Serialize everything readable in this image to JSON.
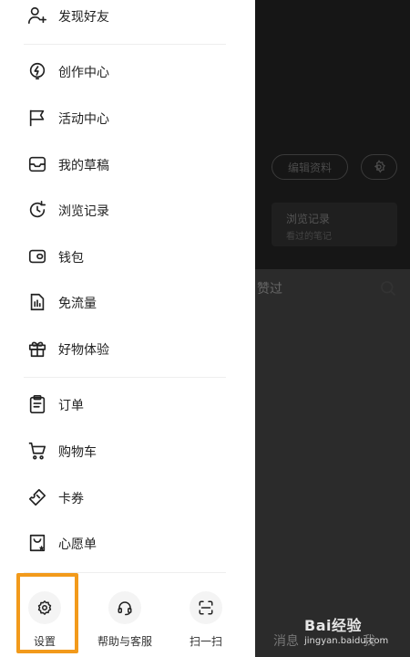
{
  "background": {
    "edit_label": "编辑资料",
    "history_title": "浏览记录",
    "history_sub": "看过的笔记",
    "seen_label": "赞过",
    "tab_messages": "消息",
    "tab_me": "我"
  },
  "watermark": {
    "logo": "Bai经验",
    "url": "jingyan.baidu.com"
  },
  "menu": {
    "find_friends": "发现好友",
    "creation_center": "创作中心",
    "activity_center": "活动中心",
    "drafts": "我的草稿",
    "history": "浏览记录",
    "wallet": "钱包",
    "free_data": "免流量",
    "goods_trial": "好物体验",
    "orders": "订单",
    "cart": "购物车",
    "coupons": "卡券",
    "wishlist": "心愿单"
  },
  "bottom": {
    "settings": "设置",
    "help": "帮助与客服",
    "scan": "扫一扫"
  },
  "colors": {
    "highlight": "#f29a1b",
    "drawer_bg": "#ffffff"
  }
}
